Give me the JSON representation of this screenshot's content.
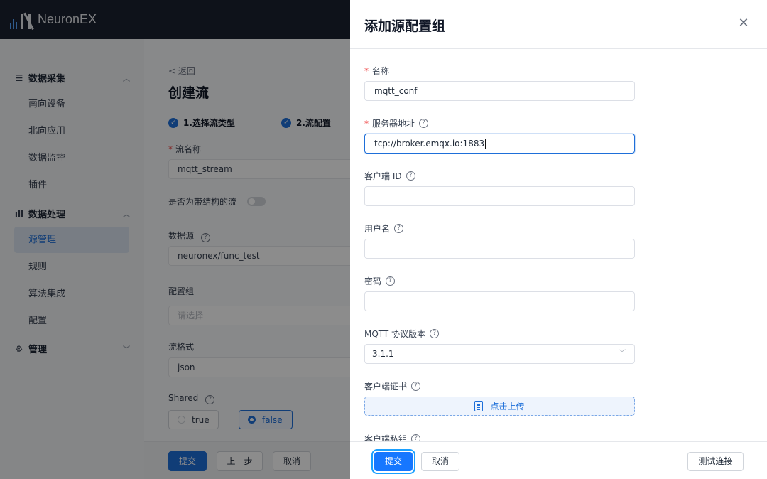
{
  "app": {
    "name": "NeuronEX"
  },
  "sidebar": {
    "groups": [
      {
        "label": "数据采集",
        "icon": "data-collect-icon"
      },
      {
        "label": "数据处理",
        "icon": "data-process-icon"
      },
      {
        "label": "管理",
        "icon": "gear-icon"
      }
    ],
    "items": [
      {
        "label": "南向设备"
      },
      {
        "label": "北向应用"
      },
      {
        "label": "数据监控"
      },
      {
        "label": "插件"
      },
      {
        "label": "源管理",
        "active": true
      },
      {
        "label": "规则"
      },
      {
        "label": "算法集成"
      },
      {
        "label": "配置"
      }
    ]
  },
  "page": {
    "back": "< 返回",
    "title": "创建流",
    "steps": [
      {
        "label": "1.选择流类型"
      },
      {
        "label": "2.流配置"
      }
    ],
    "fields": {
      "stream_name_label": "流名称",
      "stream_name_value": "mqtt_stream",
      "structured_label": "是否为带结构的流",
      "datasource_label": "数据源",
      "datasource_value": "neuronex/func_test",
      "config_group_label": "配置组",
      "config_group_placeholder": "请选择",
      "format_label": "流格式",
      "format_value": "json",
      "shared_label": "Shared",
      "shared_options": [
        "true",
        "false"
      ],
      "shared_selected": "false"
    },
    "footer": {
      "submit": "提交",
      "prev": "上一步",
      "cancel": "取消"
    }
  },
  "drawer": {
    "title": "添加源配置组",
    "fields": {
      "name_label": "名称",
      "name_value": "mqtt_conf",
      "server_label": "服务器地址",
      "server_value": "tcp://broker.emqx.io:1883",
      "client_id_label": "客户端 ID",
      "username_label": "用户名",
      "password_label": "密码",
      "protocol_label": "MQTT 协议版本",
      "protocol_value": "3.1.1",
      "client_cert_label": "客户端证书",
      "upload_label": "点击上传",
      "client_key_label": "客户端私钥"
    },
    "footer": {
      "submit": "提交",
      "cancel": "取消",
      "test": "测试连接"
    }
  },
  "colors": {
    "primary": "#1e6fd9",
    "topbar": "#1b2230",
    "required": "#ef4444"
  }
}
